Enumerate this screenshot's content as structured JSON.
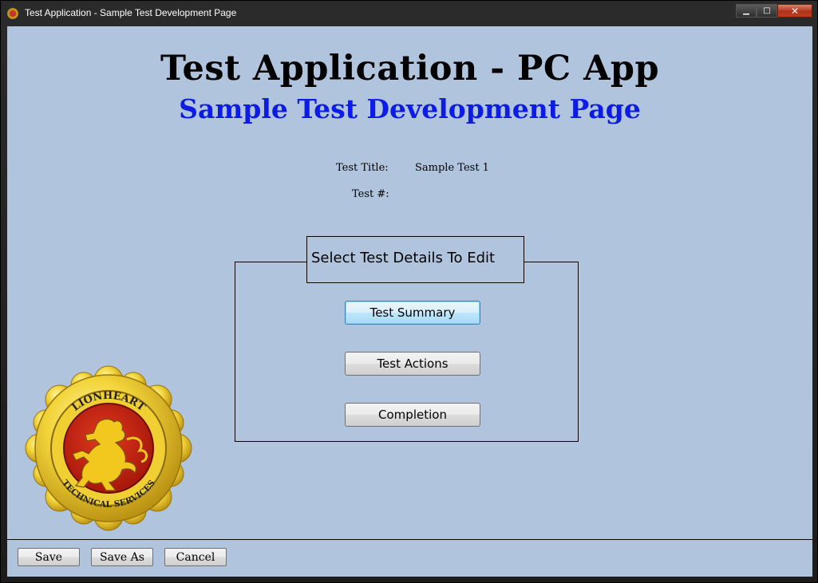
{
  "window": {
    "title": "Test Application - Sample Test Development Page",
    "controls": {
      "minimize": "▁",
      "maximize": "□",
      "close": "✕"
    }
  },
  "header": {
    "title": "Test Application - PC App",
    "subtitle": "Sample Test Development Page",
    "subtitle_color": "#0d1be6"
  },
  "fields": {
    "test_title_label": "Test Title:",
    "test_title_value": "Sample Test 1",
    "test_number_label": "Test #:",
    "test_number_value": ""
  },
  "details_group": {
    "header": "Select Test Details To Edit",
    "buttons": [
      "Test Summary",
      "Test Actions",
      "Completion"
    ]
  },
  "logo": {
    "top_text": "LIONHEART",
    "bottom_text": "TECHNICAL SERVICES",
    "icon": "lion-rampant-emblem"
  },
  "footer": {
    "save": "Save",
    "save_as": "Save As",
    "cancel": "Cancel"
  }
}
